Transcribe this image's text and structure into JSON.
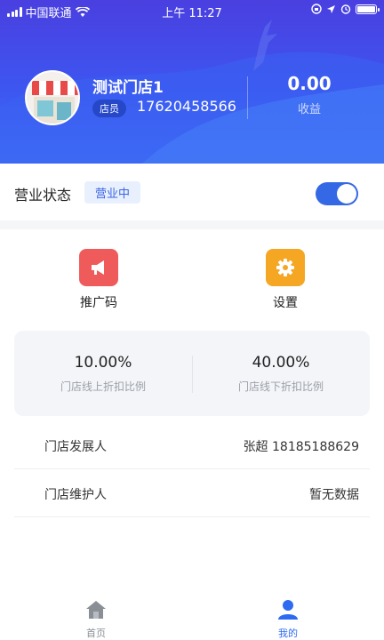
{
  "status_bar": {
    "carrier": "中国联通",
    "time": "上午 11:27"
  },
  "profile": {
    "store_name": "测试门店1",
    "role": "店员",
    "phone": "17620458566",
    "income_value": "0.00",
    "income_label": "收益"
  },
  "business": {
    "title": "营业状态",
    "status": "营业中",
    "toggle_on": true
  },
  "actions": [
    {
      "label": "推广码",
      "icon": "megaphone-icon",
      "color": "#ef5b5b"
    },
    {
      "label": "设置",
      "icon": "gear-icon",
      "color": "#f5a623"
    }
  ],
  "discounts": [
    {
      "value": "10.00%",
      "label": "门店线上折扣比例"
    },
    {
      "value": "40.00%",
      "label": "门店线下折扣比例"
    }
  ],
  "info_rows": [
    {
      "key": "门店发展人",
      "value": "张超  18185188629"
    },
    {
      "key": "门店维护人",
      "value": "暂无数据"
    }
  ],
  "tabbar": {
    "tabs": [
      {
        "label": "首页",
        "icon": "home-icon",
        "active": false
      },
      {
        "label": "我的",
        "icon": "user-icon",
        "active": true
      }
    ],
    "active_color": "#2f6bf0",
    "inactive_color": "#8a8f96"
  },
  "colors": {
    "brand_blue": "#3d56f0",
    "toggle_on": "#3568e4"
  }
}
